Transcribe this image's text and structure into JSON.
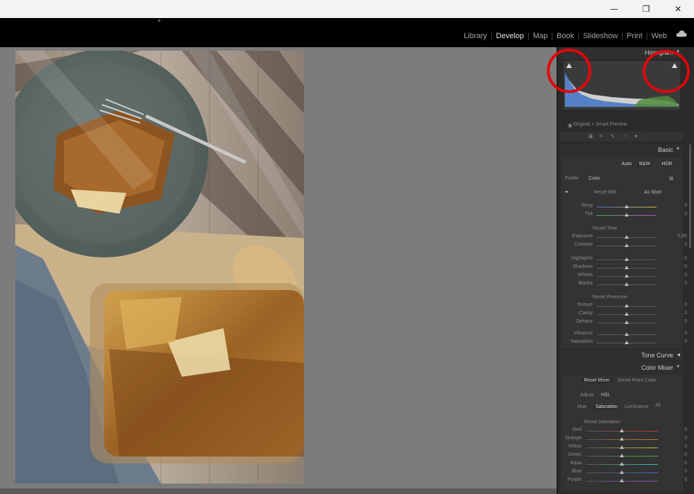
{
  "window": {
    "minimize": "—",
    "restore": "❐",
    "close": "✕"
  },
  "modules": [
    {
      "label": "Library",
      "active": false
    },
    {
      "label": "Develop",
      "active": true
    },
    {
      "label": "Map",
      "active": false
    },
    {
      "label": "Book",
      "active": false
    },
    {
      "label": "Slideshow",
      "active": false
    },
    {
      "label": "Print",
      "active": false
    },
    {
      "label": "Web",
      "active": false
    }
  ],
  "histogram": {
    "title": "Histogram",
    "info": "Original + Smart Preview"
  },
  "basic": {
    "title": "Basic",
    "auto": "Auto",
    "bw": "B&W",
    "hdr": "HDR",
    "profile_label": "Profile",
    "profile_value": "Color",
    "reset_wb": "Reset WB",
    "wb_value": "As Shot",
    "reset_tone": "Reset Tone",
    "reset_presence": "Reset Presence",
    "sliders": [
      {
        "name": "Temp",
        "value": "0"
      },
      {
        "name": "Tint",
        "value": "0"
      },
      {
        "name": "Exposure",
        "value": "0,00"
      },
      {
        "name": "Contrast",
        "value": "0"
      },
      {
        "name": "Highlights",
        "value": "0"
      },
      {
        "name": "Shadows",
        "value": "0"
      },
      {
        "name": "Whites",
        "value": "0"
      },
      {
        "name": "Blacks",
        "value": "0"
      },
      {
        "name": "Texture",
        "value": "0"
      },
      {
        "name": "Clarity",
        "value": "0"
      },
      {
        "name": "Dehaze",
        "value": "0"
      },
      {
        "name": "Vibrance",
        "value": "0"
      },
      {
        "name": "Saturation",
        "value": "0"
      }
    ]
  },
  "tone_curve": {
    "title": "Tone Curve"
  },
  "color_mixer": {
    "title": "Color Mixer",
    "reset_mixer": "Reset Mixer",
    "reset_point": "Reset Point Color",
    "adjust_label": "Adjust",
    "adjust_value": "HSL",
    "tabs": [
      "Hue",
      "Saturation",
      "Luminance",
      "All"
    ],
    "reset_saturation": "Reset Saturation",
    "sliders": [
      {
        "name": "Red",
        "value": "0"
      },
      {
        "name": "Orange",
        "value": "0"
      },
      {
        "name": "Yellow",
        "value": "0"
      },
      {
        "name": "Green",
        "value": "0"
      },
      {
        "name": "Aqua",
        "value": "0"
      },
      {
        "name": "Blue",
        "value": "0"
      },
      {
        "name": "Purple",
        "value": "0"
      }
    ]
  },
  "colors": {
    "annotation": "#e1060b",
    "panel_bg": "#2b2b2b"
  }
}
